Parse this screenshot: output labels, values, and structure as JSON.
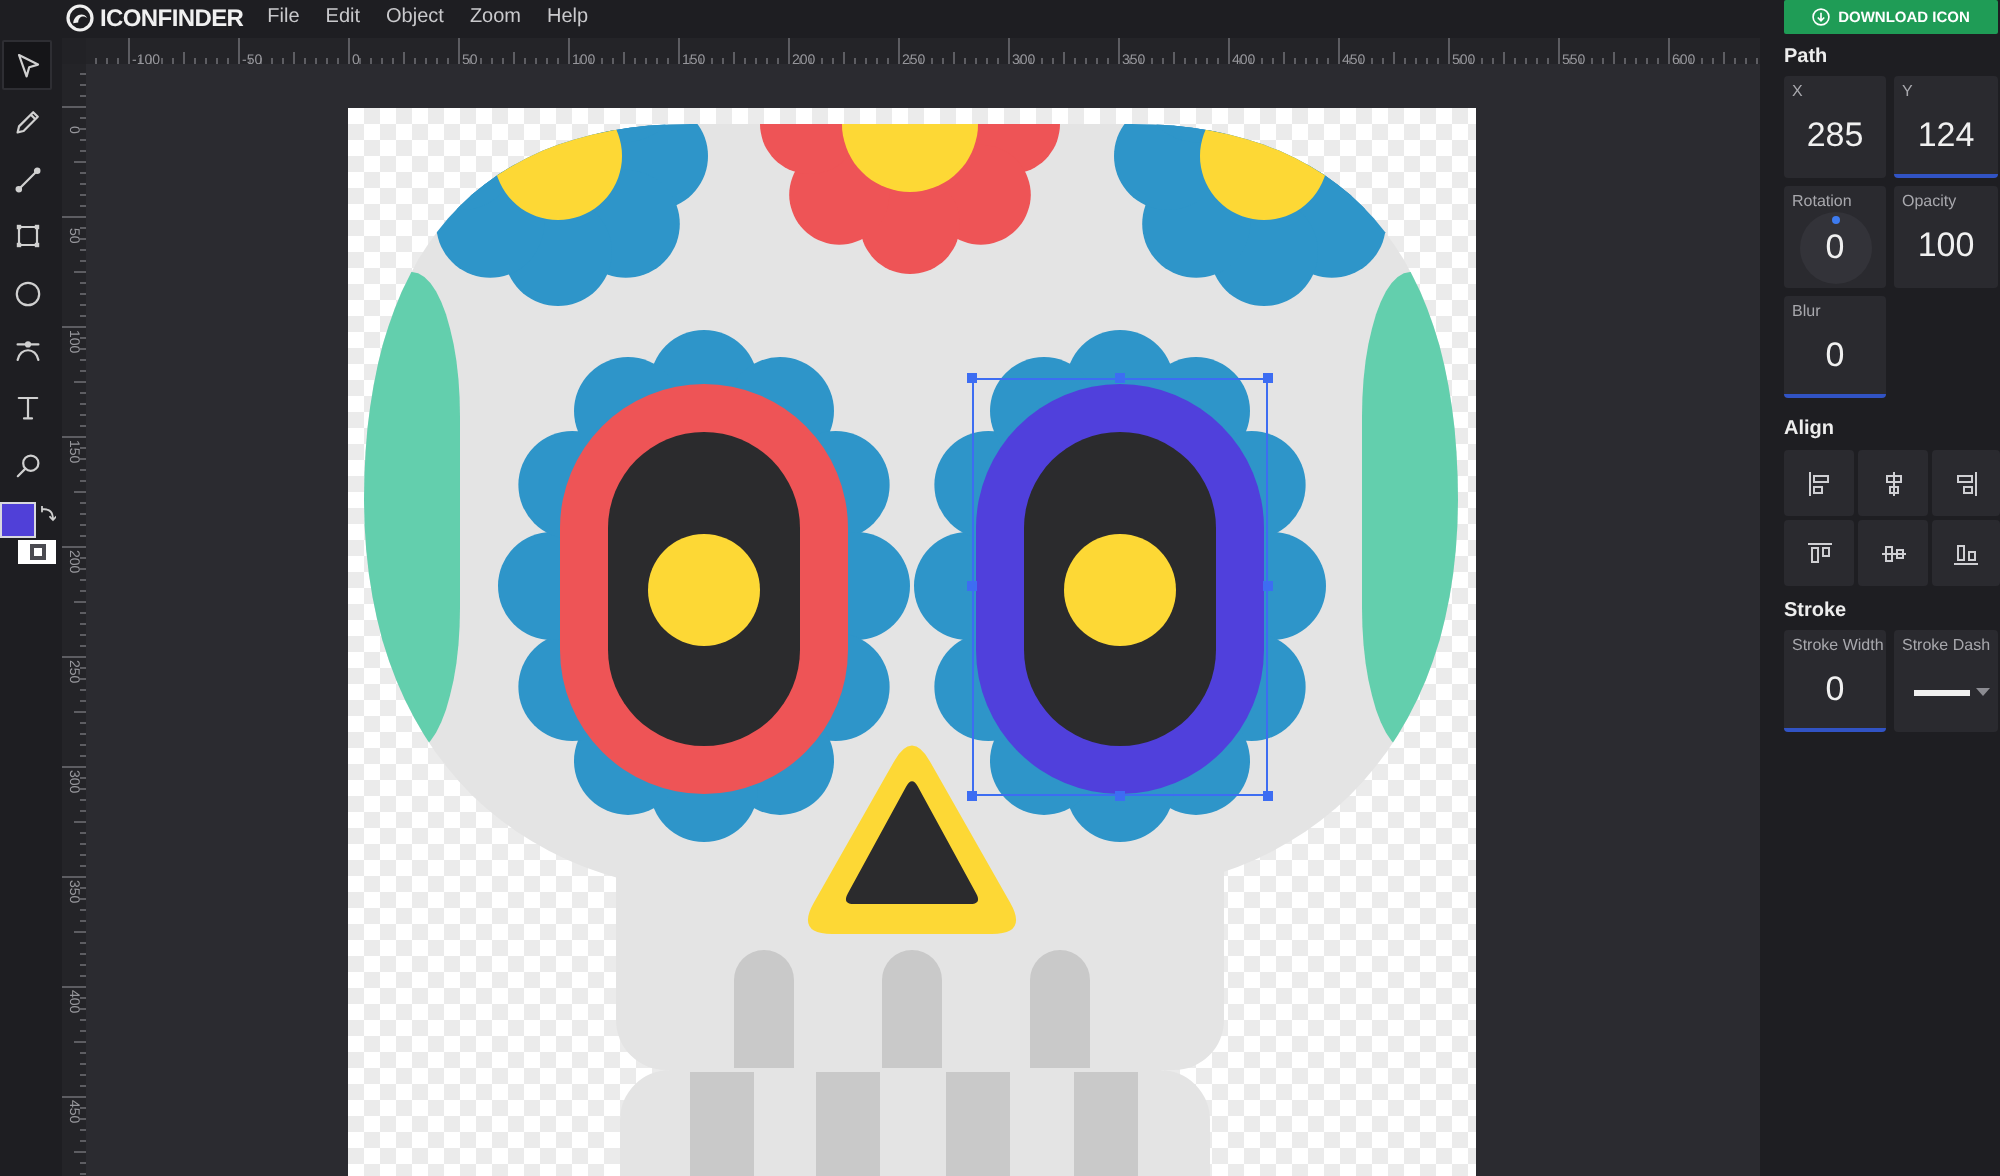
{
  "app": {
    "logo": "ICONFINDER",
    "menu": [
      "File",
      "Edit",
      "Object",
      "Zoom",
      "Help"
    ],
    "download_button": "DOWNLOAD ICON"
  },
  "tools": [
    {
      "kind": "select",
      "selected": true
    },
    {
      "kind": "pencil",
      "selected": false
    },
    {
      "kind": "line",
      "selected": false
    },
    {
      "kind": "rectangle",
      "selected": false
    },
    {
      "kind": "ellipse",
      "selected": false
    },
    {
      "kind": "curve",
      "selected": false
    },
    {
      "kind": "text",
      "selected": false
    },
    {
      "kind": "zoom",
      "selected": false
    }
  ],
  "swatches": [
    {
      "kind": "fill",
      "color": "#5040d8"
    },
    {
      "kind": "stroke",
      "color": "#ffffff"
    }
  ],
  "rulers": {
    "horizontal": [
      "-100",
      "-50",
      "0",
      "50",
      "100",
      "150",
      "200",
      "250",
      "300",
      "350",
      "400",
      "450",
      "500",
      "550",
      "600"
    ],
    "vertical": [
      "0",
      "50",
      "100",
      "150",
      "200",
      "250",
      "300",
      "350",
      "400",
      "450"
    ]
  },
  "panel": {
    "path": {
      "title": "Path",
      "fields": [
        {
          "kind": "number",
          "label": "X",
          "value": "285",
          "highlighted": false
        },
        {
          "kind": "number",
          "label": "Y",
          "value": "124",
          "highlighted": true
        },
        {
          "kind": "dial",
          "label": "Rotation",
          "value": "0",
          "highlighted": false
        },
        {
          "kind": "number",
          "label": "Opacity",
          "value": "100",
          "highlighted": false
        },
        {
          "kind": "number",
          "label": "Blur",
          "value": "0",
          "highlighted": true
        }
      ]
    },
    "align": {
      "title": "Align",
      "buttons": [
        {
          "kind": "left"
        },
        {
          "kind": "center"
        },
        {
          "kind": "right"
        },
        {
          "kind": "top"
        },
        {
          "kind": "middle"
        },
        {
          "kind": "bottom"
        }
      ]
    },
    "stroke": {
      "title": "Stroke",
      "fields": [
        {
          "kind": "number",
          "label": "Stroke Width",
          "value": "0",
          "highlighted": true
        },
        {
          "kind": "dash",
          "label": "Stroke Dash",
          "highlighted": false
        }
      ]
    }
  }
}
